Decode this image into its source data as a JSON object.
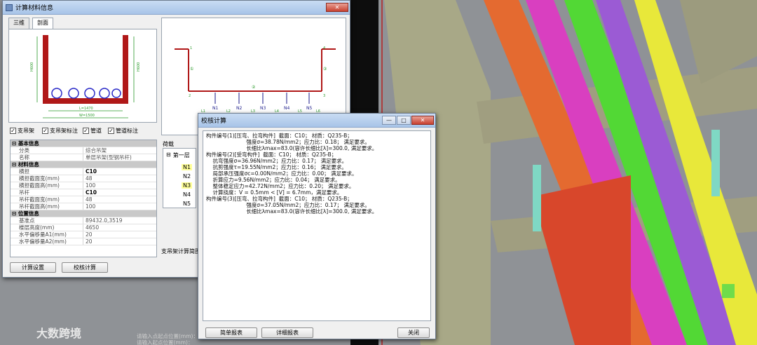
{
  "viewport": {
    "bg": "#8f9296"
  },
  "calc_window": {
    "title": "计算材料信息",
    "tabs": [
      "三维",
      "剖面"
    ],
    "section_dims": {
      "left_h": "H600",
      "right_h": "H600",
      "inner_w": "L=1470",
      "outer_w": "W=1500"
    },
    "checkboxes": [
      "支吊架",
      "支吊架标注",
      "管道",
      "管道标注"
    ],
    "props": [
      {
        "cat": "基本信息"
      },
      {
        "k": "分类",
        "v": "综合吊架"
      },
      {
        "k": "名称",
        "v": "单层吊架(型钢吊杆)"
      },
      {
        "cat": "材料信息"
      },
      {
        "k": "横担",
        "v": "C10",
        "bold": true
      },
      {
        "k": "横担截面宽(mm)",
        "v": "48"
      },
      {
        "k": "横担截面高(mm)",
        "v": "100"
      },
      {
        "k": "吊杆",
        "v": "C10",
        "bold": true
      },
      {
        "k": "吊杆截面宽(mm)",
        "v": "48"
      },
      {
        "k": "吊杆截面高(mm)",
        "v": "100"
      },
      {
        "cat": "位置信息"
      },
      {
        "k": "基准点",
        "v": "89432.0,3519"
      },
      {
        "k": "楼层高度(mm)",
        "v": "4650"
      },
      {
        "k": "水平偏移量A1(mm)",
        "v": "20"
      },
      {
        "k": "水平偏移量A2(mm)",
        "v": "20"
      }
    ],
    "btn_calc_settings": "计算设置",
    "btn_check": "校核计算",
    "load_label": "荷载",
    "load_tree": {
      "root": "第一层",
      "nodes": [
        "N1",
        "N2",
        "N3",
        "N4",
        "N5"
      ]
    },
    "diagram": {
      "nodes": [
        "N1",
        "N2",
        "N3",
        "N4",
        "N5"
      ],
      "spans": [
        "L1",
        "L2",
        "L3",
        "L4",
        "L5",
        "L6"
      ],
      "points": [
        "1",
        "2",
        "3",
        "4"
      ],
      "members": [
        "①",
        "②",
        "③"
      ]
    },
    "footer_text": "支吊架计算简图"
  },
  "check_window": {
    "title": "校核计算",
    "lines": [
      "构件编号(1)[压弯、拉弯构件]  截面：C10； 材质：Q235-B；",
      "                        强度σ=38.78N/mm2；应力比：0.18； 满足要求。",
      "                        长细比λmax=83.0(容许长细比[λ]=300.0, 满足要求。",
      "构件编号(2)[受弯构件]  截面：C10； 材质：Q235-B；",
      "    抗弯强度σ=36.96N/mm2；应力比：0.17； 满足要求。",
      "    抗剪强度τ=19.55N/mm2；应力比：0.16； 满足要求。",
      "    局部承压强度σc=0.00N/mm2；应力比：0.00； 满足要求。",
      "    折算应力=9.56N/mm2；应力比：0.04； 满足要求。",
      "    整体稳定应力=42.72N/mm2；应力比：0.20； 满足要求。",
      "    计算挠度：V = 0.5mm < [V] = 6.7mm，满足要求。",
      "构件编号(3)[压弯、拉弯构件]  截面：C10； 材质：Q235-B；",
      "                        强度σ=37.05N/mm2；应力比：0.17； 满足要求。",
      "                        长细比λmax=83.0(容许长细比[λ]=300.0, 满足要求。"
    ],
    "btn_simple": "简单报表",
    "btn_detail": "详细报表",
    "btn_close": "关闭"
  },
  "status_lines": [
    "请输入点起点位置(mm)：",
    "请输入起点位置(mm)："
  ],
  "watermark": "大数跨境"
}
